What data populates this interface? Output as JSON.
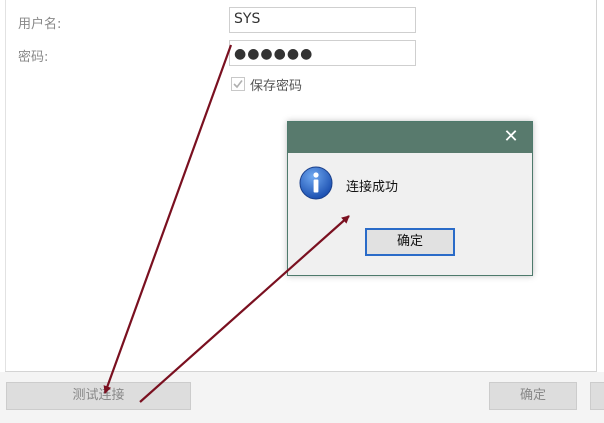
{
  "form": {
    "username_label": "用户名:",
    "username_value": "SYS",
    "password_label": "密码:",
    "password_value": "●●●●●●",
    "remember_label": "保存密码",
    "remember_checked": true
  },
  "footer": {
    "test_button": "测试连接",
    "save_button": "确定"
  },
  "dialog": {
    "message": "连接成功",
    "ok_button": "确定",
    "close_glyph": "✕",
    "icon": "info-icon",
    "titlebar_color": "#587a6d"
  },
  "annotations": {
    "arrow_color": "#7a1020"
  }
}
